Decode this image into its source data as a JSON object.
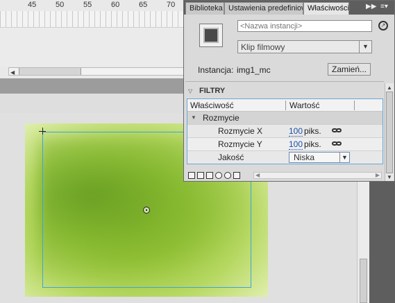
{
  "timeline": {
    "ruler_numbers": [
      "45",
      "50",
      "55",
      "60",
      "65",
      "70"
    ]
  },
  "panel": {
    "tabs": [
      {
        "label": "Biblioteka",
        "active": false
      },
      {
        "label": "Ustawienia predefiniow",
        "active": false
      },
      {
        "label": "Właściwości",
        "active": true
      }
    ],
    "tab_overflow_icon": "double-chevron-right-icon",
    "menu_icon": "panel-menu-icon",
    "instance_name_placeholder": "<Nazwa instancji>",
    "symbol_type": "Klip filmowy",
    "instance_label": "Instancja:",
    "instance_value": "img1_mc",
    "swap_button": "Zamień...",
    "filters_title": "FILTRY",
    "filter_table": {
      "col_property": "Właściwość",
      "col_value": "Wartość",
      "group": "Rozmycie",
      "rows": [
        {
          "label": "Rozmycie X",
          "value": "100",
          "unit": "piks."
        },
        {
          "label": "Rozmycie Y",
          "value": "100",
          "unit": "piks."
        },
        {
          "label": "Jakość",
          "select": "Niska"
        }
      ]
    }
  },
  "colors": {
    "accent_blue": "#3ea3d9",
    "link_value": "#1a4ea8",
    "clip_green": "#9ac63b"
  }
}
